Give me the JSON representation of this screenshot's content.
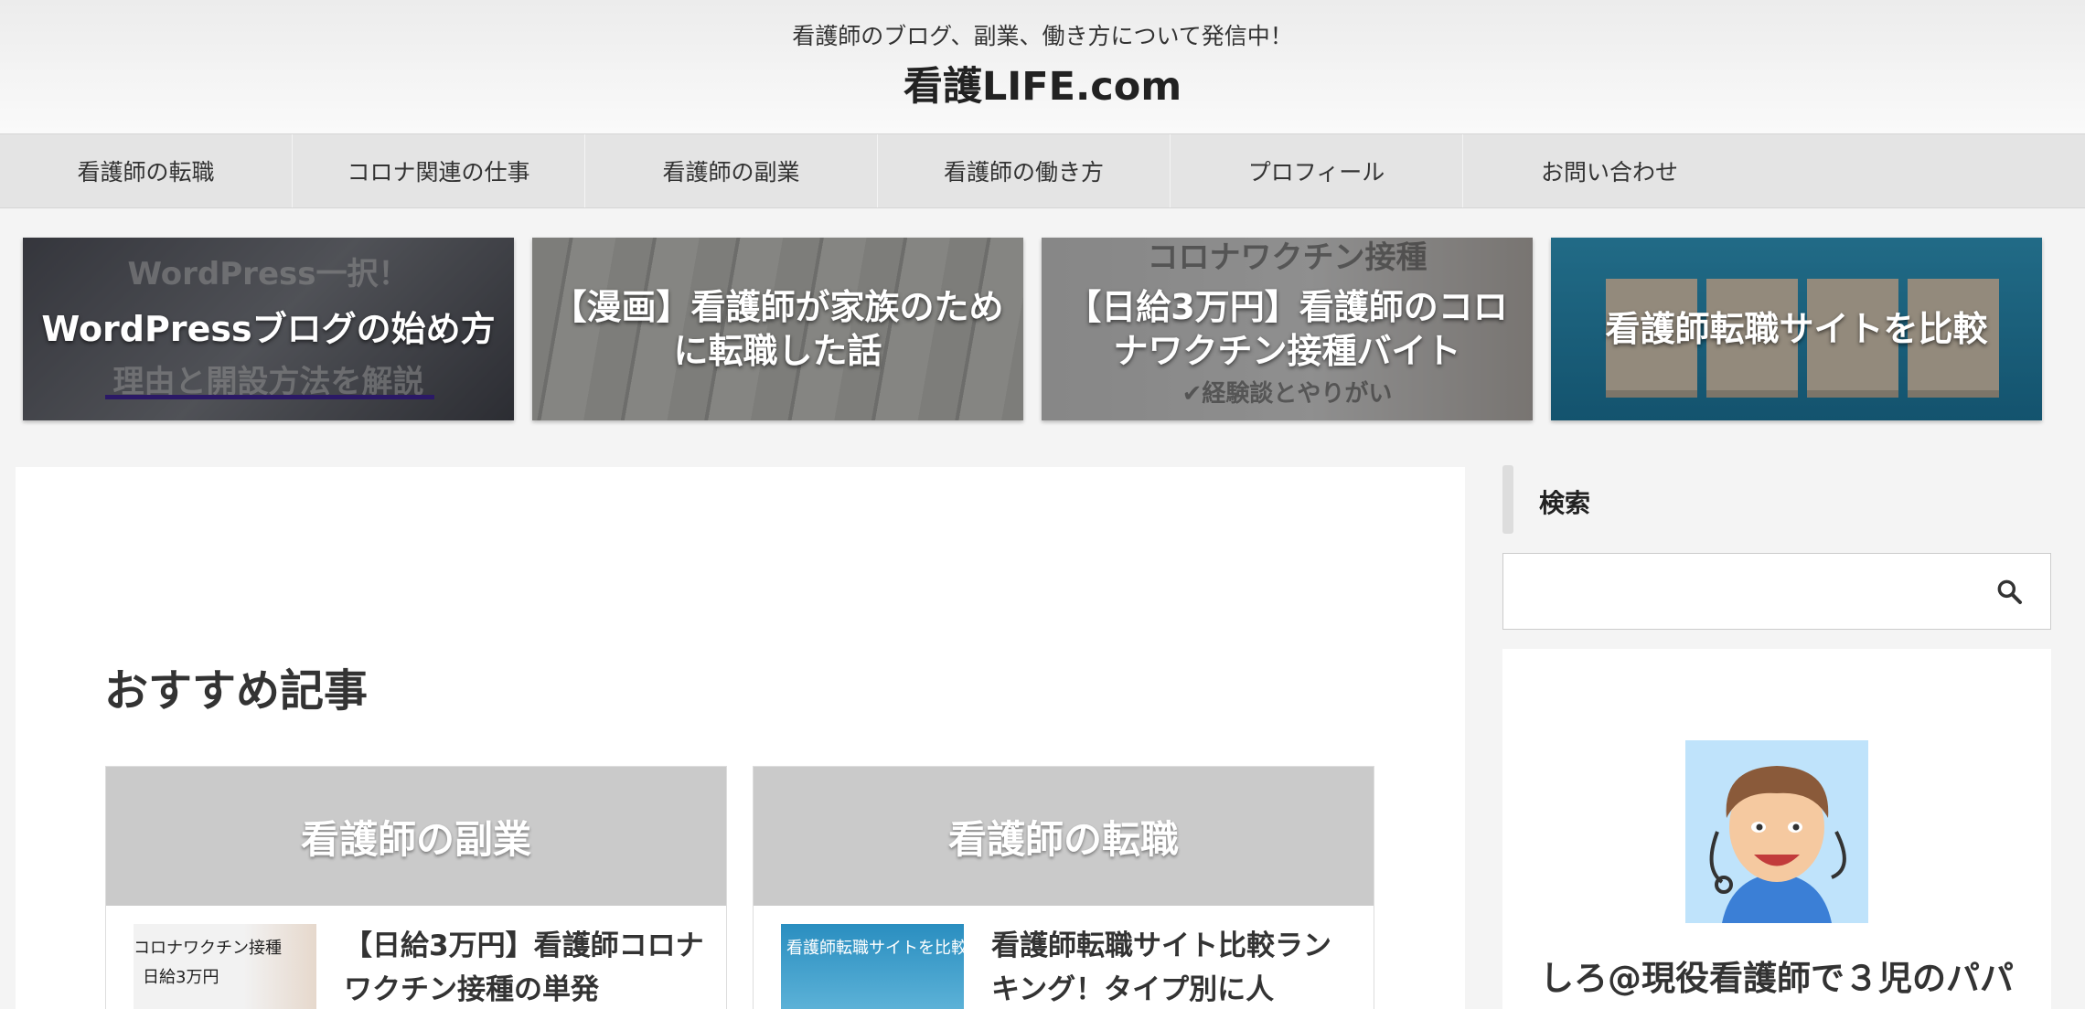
{
  "header": {
    "tagline": "看護師のブログ、副業、働き方について発信中！",
    "site_title": "看護LIFE.com"
  },
  "nav": {
    "items": [
      {
        "label": "看護師の転職"
      },
      {
        "label": "コロナ関連の仕事"
      },
      {
        "label": "看護師の副業"
      },
      {
        "label": "看護師の働き方"
      },
      {
        "label": "プロフィール"
      },
      {
        "label": "お問い合わせ"
      }
    ]
  },
  "featured": [
    {
      "title": "WordPressブログの始め方",
      "bg_text_top": "WordPress一択！",
      "bg_text_bottom": "理由と開設方法を解説"
    },
    {
      "title": "【漫画】看護師が家族のために転職した話"
    },
    {
      "title": "【日給3万円】看護師のコロナワクチン接種バイト",
      "bg_text_top": "コロナワクチン接種",
      "bg_text_bottom": "✔経験談とやりがい"
    },
    {
      "title": "看護師転職サイトを比較"
    }
  ],
  "main": {
    "section_title": "おすすめ記事",
    "boxes": [
      {
        "heading": "看護師の副業",
        "article_title": "【日給3万円】看護師コロナワクチン接種の単発",
        "thumb_text": "コロナワクチン接種",
        "thumb_text2": "日給3万円"
      },
      {
        "heading": "看護師の転職",
        "article_title": "看護師転職サイト比較ランキング！タイプ別に人",
        "thumb_text": "看護師転職サイトを比較"
      }
    ]
  },
  "sidebar": {
    "search_label": "検索",
    "search_placeholder": "",
    "profile_name": "しろ@現役看護師で３児のパパ"
  },
  "colors": {
    "nav_bg": "#e4e4e4",
    "rec_head_bg": "#cacaca",
    "accent_underline": "#4a2bb0"
  }
}
